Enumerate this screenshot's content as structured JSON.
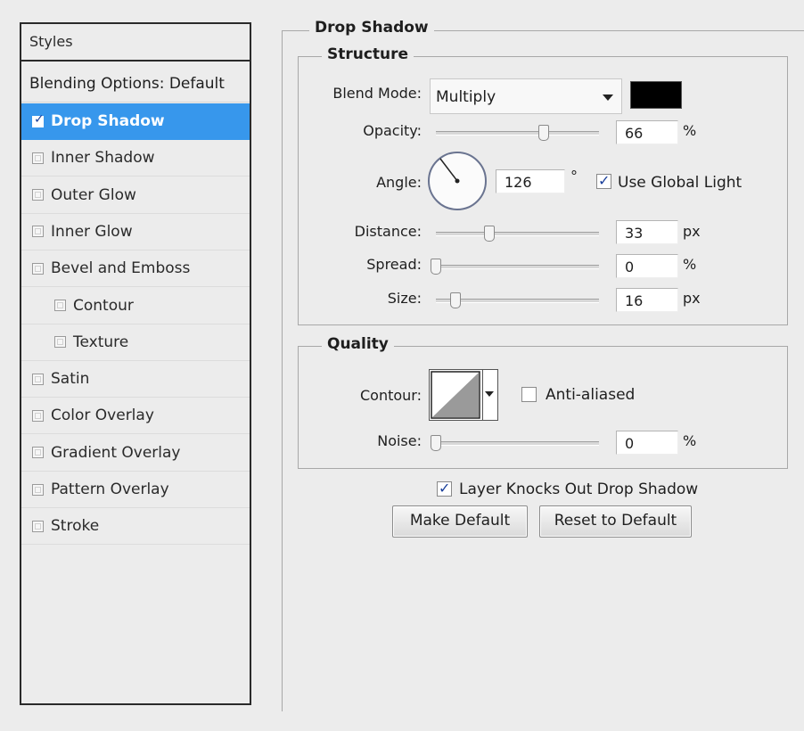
{
  "left_panel": {
    "header": "Styles",
    "blending_options": "Blending Options: Default",
    "items": [
      {
        "label": "Drop Shadow",
        "checked": true,
        "selected": true,
        "indent": false
      },
      {
        "label": "Inner Shadow",
        "checked": false,
        "selected": false,
        "indent": false
      },
      {
        "label": "Outer Glow",
        "checked": false,
        "selected": false,
        "indent": false
      },
      {
        "label": "Inner Glow",
        "checked": false,
        "selected": false,
        "indent": false
      },
      {
        "label": "Bevel and Emboss",
        "checked": false,
        "selected": false,
        "indent": false
      },
      {
        "label": "Contour",
        "checked": false,
        "selected": false,
        "indent": true
      },
      {
        "label": "Texture",
        "checked": false,
        "selected": false,
        "indent": true
      },
      {
        "label": "Satin",
        "checked": false,
        "selected": false,
        "indent": false
      },
      {
        "label": "Color Overlay",
        "checked": false,
        "selected": false,
        "indent": false
      },
      {
        "label": "Gradient Overlay",
        "checked": false,
        "selected": false,
        "indent": false
      },
      {
        "label": "Pattern Overlay",
        "checked": false,
        "selected": false,
        "indent": false
      },
      {
        "label": "Stroke",
        "checked": false,
        "selected": false,
        "indent": false
      }
    ]
  },
  "drop_shadow": {
    "title": "Drop Shadow",
    "structure": {
      "title": "Structure",
      "blend_mode_label": "Blend Mode:",
      "blend_mode_value": "Multiply",
      "shadow_color": "#000000",
      "opacity_label": "Opacity:",
      "opacity_value": "66",
      "opacity_unit": "%",
      "angle_label": "Angle:",
      "angle_value": "126",
      "angle_unit": "°",
      "use_global_light_label": "Use Global Light",
      "use_global_light_checked": true,
      "distance_label": "Distance:",
      "distance_value": "33",
      "distance_unit": "px",
      "spread_label": "Spread:",
      "spread_value": "0",
      "spread_unit": "%",
      "size_label": "Size:",
      "size_value": "16",
      "size_unit": "px"
    },
    "quality": {
      "title": "Quality",
      "contour_label": "Contour:",
      "anti_aliased_label": "Anti-aliased",
      "anti_aliased_checked": false,
      "noise_label": "Noise:",
      "noise_value": "0",
      "noise_unit": "%"
    },
    "layer_knocks_out_label": "Layer Knocks Out Drop Shadow",
    "layer_knocks_out_checked": true,
    "make_default_label": "Make Default",
    "reset_default_label": "Reset to Default"
  }
}
